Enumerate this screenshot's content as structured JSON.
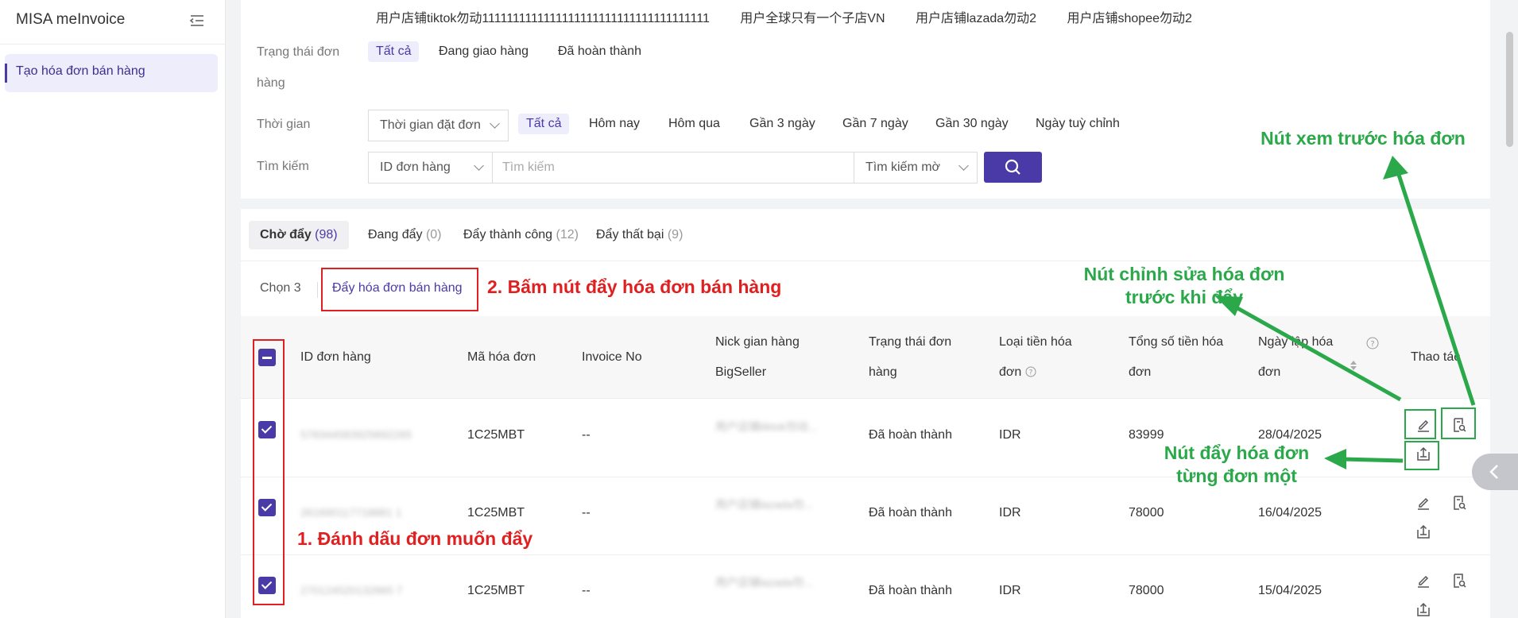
{
  "sidebar": {
    "brand": "MISA meInvoice",
    "nav_item": "Tạo hóa đơn bán hàng"
  },
  "filters": {
    "shops": [
      "用户店铺tiktok勿动1111111111111111111111111111111111111",
      "用户全球只有一个子店VN",
      "用户店铺lazada勿动2",
      "用户店铺shopee勿动2"
    ],
    "status_label_1": "Trạng thái đơn",
    "status_label_2": "hàng",
    "status_options": [
      "Tất cả",
      "Đang giao hàng",
      "Đã hoàn thành"
    ],
    "time_label": "Thời gian",
    "time_select": "Thời gian đặt đơn",
    "time_options": [
      "Tất cả",
      "Hôm nay",
      "Hôm qua",
      "Gần 3 ngày",
      "Gần 7 ngày",
      "Gần 30 ngày",
      "Ngày tuỳ chỉnh"
    ],
    "search_label": "Tìm kiếm",
    "search_field_select": "ID đơn hàng",
    "search_placeholder": "Tìm kiếm",
    "search_mode_select": "Tìm kiếm mờ"
  },
  "tabs": [
    {
      "label": "Chờ đẩy",
      "count": "(98)"
    },
    {
      "label": "Đang đẩy",
      "count": "(0)"
    },
    {
      "label": "Đẩy thành công",
      "count": "(12)"
    },
    {
      "label": "Đẩy thất bại",
      "count": "(9)"
    }
  ],
  "actions": {
    "selected": "Chọn 3",
    "push_button": "Đẩy hóa đơn bán hàng"
  },
  "columns": {
    "order_id": "ID đơn hàng",
    "invoice_code": "Mã hóa đơn",
    "invoice_no": "Invoice No",
    "nick_1": "Nick gian hàng",
    "nick_2": "BigSeller",
    "status_1": "Trạng thái đơn",
    "status_2": "hàng",
    "currency_1": "Loại tiền hóa",
    "currency_2": "đơn",
    "total_1": "Tổng số tiền hóa",
    "total_2": "đơn",
    "date_1": "Ngày lập hóa",
    "date_2": "đơn",
    "actions": "Thao tác"
  },
  "rows": [
    {
      "order_id": "578344583925892265",
      "invoice_code": "1C25MBT",
      "invoice_no": "--",
      "nick": "用户店铺tiktok勿动...",
      "status": "Đã hoàn thành",
      "currency": "IDR",
      "total": "83999",
      "date": "28/04/2025"
    },
    {
      "order_id": "261690117718881 1",
      "invoice_code": "1C25MBT",
      "invoice_no": "--",
      "nick": "用户店铺lazada勿...",
      "status": "Đã hoàn thành",
      "currency": "IDR",
      "total": "78000",
      "date": "16/04/2025"
    },
    {
      "order_id": "270124520132865 7",
      "invoice_code": "1C25MBT",
      "invoice_no": "--",
      "nick": "用户店铺lazada勿...",
      "status": "Đã hoàn thành",
      "currency": "IDR",
      "total": "78000",
      "date": "15/04/2025"
    }
  ],
  "annotations": {
    "step1": "1. Đánh dấu đơn muốn đẩy",
    "step2": "2. Bấm nút đẩy hóa đơn bán hàng",
    "preview_1": "Nút xem trước hóa đơn",
    "edit_1": "Nút chỉnh sửa hóa đơn",
    "edit_2": "trước khi đẩy",
    "push_one_1": "Nút đẩy hóa đơn",
    "push_one_2": "từng đơn một"
  },
  "colors": {
    "accent": "#4a3aa8",
    "annotation_red": "#e02020",
    "annotation_green": "#2aa84a"
  }
}
